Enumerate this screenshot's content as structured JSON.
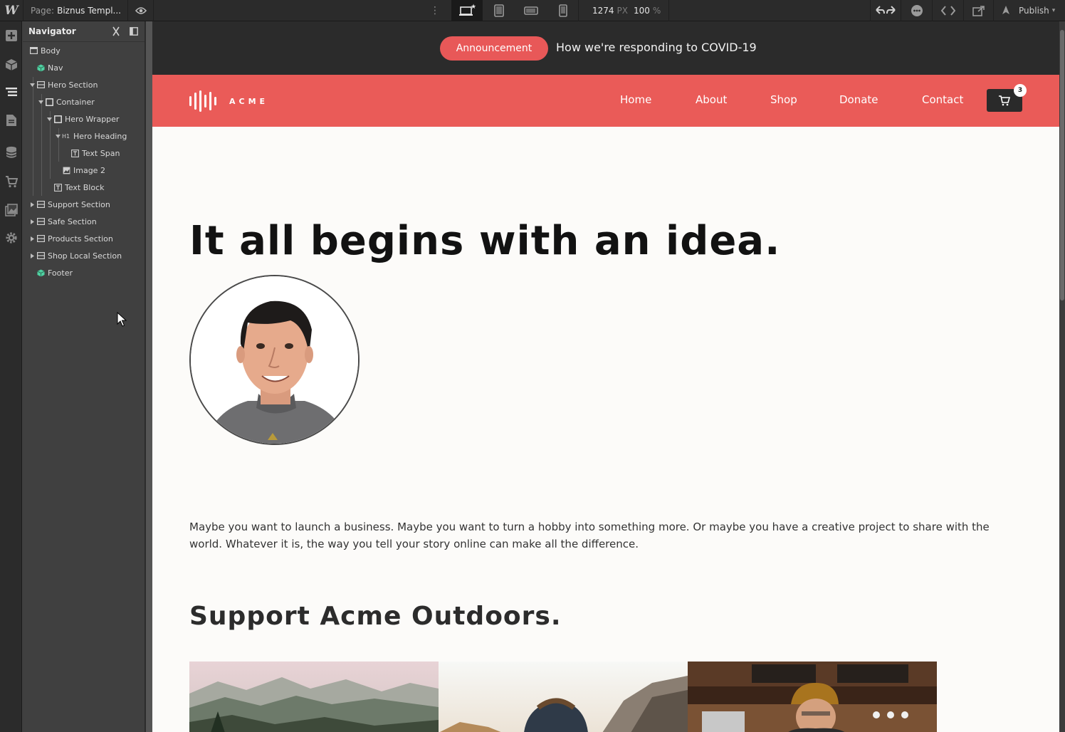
{
  "topbar": {
    "page_prefix": "Page:",
    "page_name": "Biznus Templ...",
    "canvas_width": "1274",
    "width_unit": "PX",
    "zoom": "100",
    "zoom_unit": "%",
    "publish_label": "Publish"
  },
  "navigator": {
    "title": "Navigator",
    "items": [
      {
        "label": "Body"
      },
      {
        "label": "Nav"
      },
      {
        "label": "Hero Section"
      },
      {
        "label": "Container"
      },
      {
        "label": "Hero Wrapper"
      },
      {
        "label": "Hero Heading",
        "tag": "H1"
      },
      {
        "label": "Text Span"
      },
      {
        "label": "Image 2"
      },
      {
        "label": "Text Block"
      },
      {
        "label": "Support Section"
      },
      {
        "label": "Safe Section"
      },
      {
        "label": "Products Section"
      },
      {
        "label": "Shop Local Section"
      },
      {
        "label": "Footer"
      }
    ]
  },
  "site": {
    "announcement": {
      "pill": "Announcement",
      "message": "How we're responding to COVID-19"
    },
    "brand": "ACME",
    "nav_links": [
      "Home",
      "About",
      "Shop",
      "Donate",
      "Contact"
    ],
    "cart_count": "3",
    "hero_heading": "It all begins with an idea.",
    "body_text": "Maybe you want to launch a business. Maybe you want to turn a hobby into something more. Or maybe you have a creative project to share with the world. Whatever it is, the way you tell your story online can make all the difference.",
    "support_heading": "Support Acme Outdoors."
  },
  "colors": {
    "accent": "#ea5b58",
    "dark": "#2b2b2b",
    "component_green": "#4fd1a1"
  }
}
